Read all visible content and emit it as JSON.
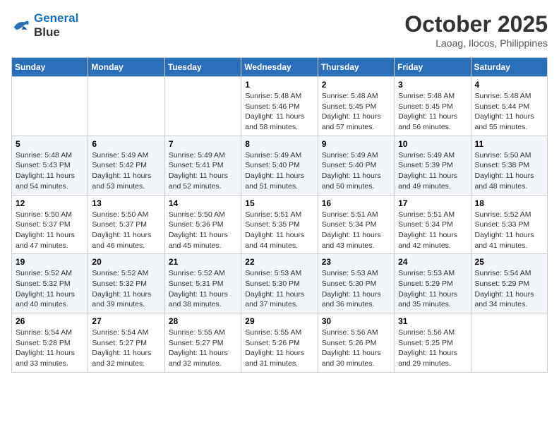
{
  "logo": {
    "line1": "General",
    "line2": "Blue"
  },
  "header": {
    "month": "October 2025",
    "location": "Laoag, Ilocos, Philippines"
  },
  "weekdays": [
    "Sunday",
    "Monday",
    "Tuesday",
    "Wednesday",
    "Thursday",
    "Friday",
    "Saturday"
  ],
  "weeks": [
    [
      {
        "day": "",
        "sunrise": "",
        "sunset": "",
        "daylight": ""
      },
      {
        "day": "",
        "sunrise": "",
        "sunset": "",
        "daylight": ""
      },
      {
        "day": "",
        "sunrise": "",
        "sunset": "",
        "daylight": ""
      },
      {
        "day": "1",
        "sunrise": "Sunrise: 5:48 AM",
        "sunset": "Sunset: 5:46 PM",
        "daylight": "Daylight: 11 hours and 58 minutes."
      },
      {
        "day": "2",
        "sunrise": "Sunrise: 5:48 AM",
        "sunset": "Sunset: 5:45 PM",
        "daylight": "Daylight: 11 hours and 57 minutes."
      },
      {
        "day": "3",
        "sunrise": "Sunrise: 5:48 AM",
        "sunset": "Sunset: 5:45 PM",
        "daylight": "Daylight: 11 hours and 56 minutes."
      },
      {
        "day": "4",
        "sunrise": "Sunrise: 5:48 AM",
        "sunset": "Sunset: 5:44 PM",
        "daylight": "Daylight: 11 hours and 55 minutes."
      }
    ],
    [
      {
        "day": "5",
        "sunrise": "Sunrise: 5:48 AM",
        "sunset": "Sunset: 5:43 PM",
        "daylight": "Daylight: 11 hours and 54 minutes."
      },
      {
        "day": "6",
        "sunrise": "Sunrise: 5:49 AM",
        "sunset": "Sunset: 5:42 PM",
        "daylight": "Daylight: 11 hours and 53 minutes."
      },
      {
        "day": "7",
        "sunrise": "Sunrise: 5:49 AM",
        "sunset": "Sunset: 5:41 PM",
        "daylight": "Daylight: 11 hours and 52 minutes."
      },
      {
        "day": "8",
        "sunrise": "Sunrise: 5:49 AM",
        "sunset": "Sunset: 5:40 PM",
        "daylight": "Daylight: 11 hours and 51 minutes."
      },
      {
        "day": "9",
        "sunrise": "Sunrise: 5:49 AM",
        "sunset": "Sunset: 5:40 PM",
        "daylight": "Daylight: 11 hours and 50 minutes."
      },
      {
        "day": "10",
        "sunrise": "Sunrise: 5:49 AM",
        "sunset": "Sunset: 5:39 PM",
        "daylight": "Daylight: 11 hours and 49 minutes."
      },
      {
        "day": "11",
        "sunrise": "Sunrise: 5:50 AM",
        "sunset": "Sunset: 5:38 PM",
        "daylight": "Daylight: 11 hours and 48 minutes."
      }
    ],
    [
      {
        "day": "12",
        "sunrise": "Sunrise: 5:50 AM",
        "sunset": "Sunset: 5:37 PM",
        "daylight": "Daylight: 11 hours and 47 minutes."
      },
      {
        "day": "13",
        "sunrise": "Sunrise: 5:50 AM",
        "sunset": "Sunset: 5:37 PM",
        "daylight": "Daylight: 11 hours and 46 minutes."
      },
      {
        "day": "14",
        "sunrise": "Sunrise: 5:50 AM",
        "sunset": "Sunset: 5:36 PM",
        "daylight": "Daylight: 11 hours and 45 minutes."
      },
      {
        "day": "15",
        "sunrise": "Sunrise: 5:51 AM",
        "sunset": "Sunset: 5:35 PM",
        "daylight": "Daylight: 11 hours and 44 minutes."
      },
      {
        "day": "16",
        "sunrise": "Sunrise: 5:51 AM",
        "sunset": "Sunset: 5:34 PM",
        "daylight": "Daylight: 11 hours and 43 minutes."
      },
      {
        "day": "17",
        "sunrise": "Sunrise: 5:51 AM",
        "sunset": "Sunset: 5:34 PM",
        "daylight": "Daylight: 11 hours and 42 minutes."
      },
      {
        "day": "18",
        "sunrise": "Sunrise: 5:52 AM",
        "sunset": "Sunset: 5:33 PM",
        "daylight": "Daylight: 11 hours and 41 minutes."
      }
    ],
    [
      {
        "day": "19",
        "sunrise": "Sunrise: 5:52 AM",
        "sunset": "Sunset: 5:32 PM",
        "daylight": "Daylight: 11 hours and 40 minutes."
      },
      {
        "day": "20",
        "sunrise": "Sunrise: 5:52 AM",
        "sunset": "Sunset: 5:32 PM",
        "daylight": "Daylight: 11 hours and 39 minutes."
      },
      {
        "day": "21",
        "sunrise": "Sunrise: 5:52 AM",
        "sunset": "Sunset: 5:31 PM",
        "daylight": "Daylight: 11 hours and 38 minutes."
      },
      {
        "day": "22",
        "sunrise": "Sunrise: 5:53 AM",
        "sunset": "Sunset: 5:30 PM",
        "daylight": "Daylight: 11 hours and 37 minutes."
      },
      {
        "day": "23",
        "sunrise": "Sunrise: 5:53 AM",
        "sunset": "Sunset: 5:30 PM",
        "daylight": "Daylight: 11 hours and 36 minutes."
      },
      {
        "day": "24",
        "sunrise": "Sunrise: 5:53 AM",
        "sunset": "Sunset: 5:29 PM",
        "daylight": "Daylight: 11 hours and 35 minutes."
      },
      {
        "day": "25",
        "sunrise": "Sunrise: 5:54 AM",
        "sunset": "Sunset: 5:29 PM",
        "daylight": "Daylight: 11 hours and 34 minutes."
      }
    ],
    [
      {
        "day": "26",
        "sunrise": "Sunrise: 5:54 AM",
        "sunset": "Sunset: 5:28 PM",
        "daylight": "Daylight: 11 hours and 33 minutes."
      },
      {
        "day": "27",
        "sunrise": "Sunrise: 5:54 AM",
        "sunset": "Sunset: 5:27 PM",
        "daylight": "Daylight: 11 hours and 32 minutes."
      },
      {
        "day": "28",
        "sunrise": "Sunrise: 5:55 AM",
        "sunset": "Sunset: 5:27 PM",
        "daylight": "Daylight: 11 hours and 32 minutes."
      },
      {
        "day": "29",
        "sunrise": "Sunrise: 5:55 AM",
        "sunset": "Sunset: 5:26 PM",
        "daylight": "Daylight: 11 hours and 31 minutes."
      },
      {
        "day": "30",
        "sunrise": "Sunrise: 5:56 AM",
        "sunset": "Sunset: 5:26 PM",
        "daylight": "Daylight: 11 hours and 30 minutes."
      },
      {
        "day": "31",
        "sunrise": "Sunrise: 5:56 AM",
        "sunset": "Sunset: 5:25 PM",
        "daylight": "Daylight: 11 hours and 29 minutes."
      },
      {
        "day": "",
        "sunrise": "",
        "sunset": "",
        "daylight": ""
      }
    ]
  ]
}
